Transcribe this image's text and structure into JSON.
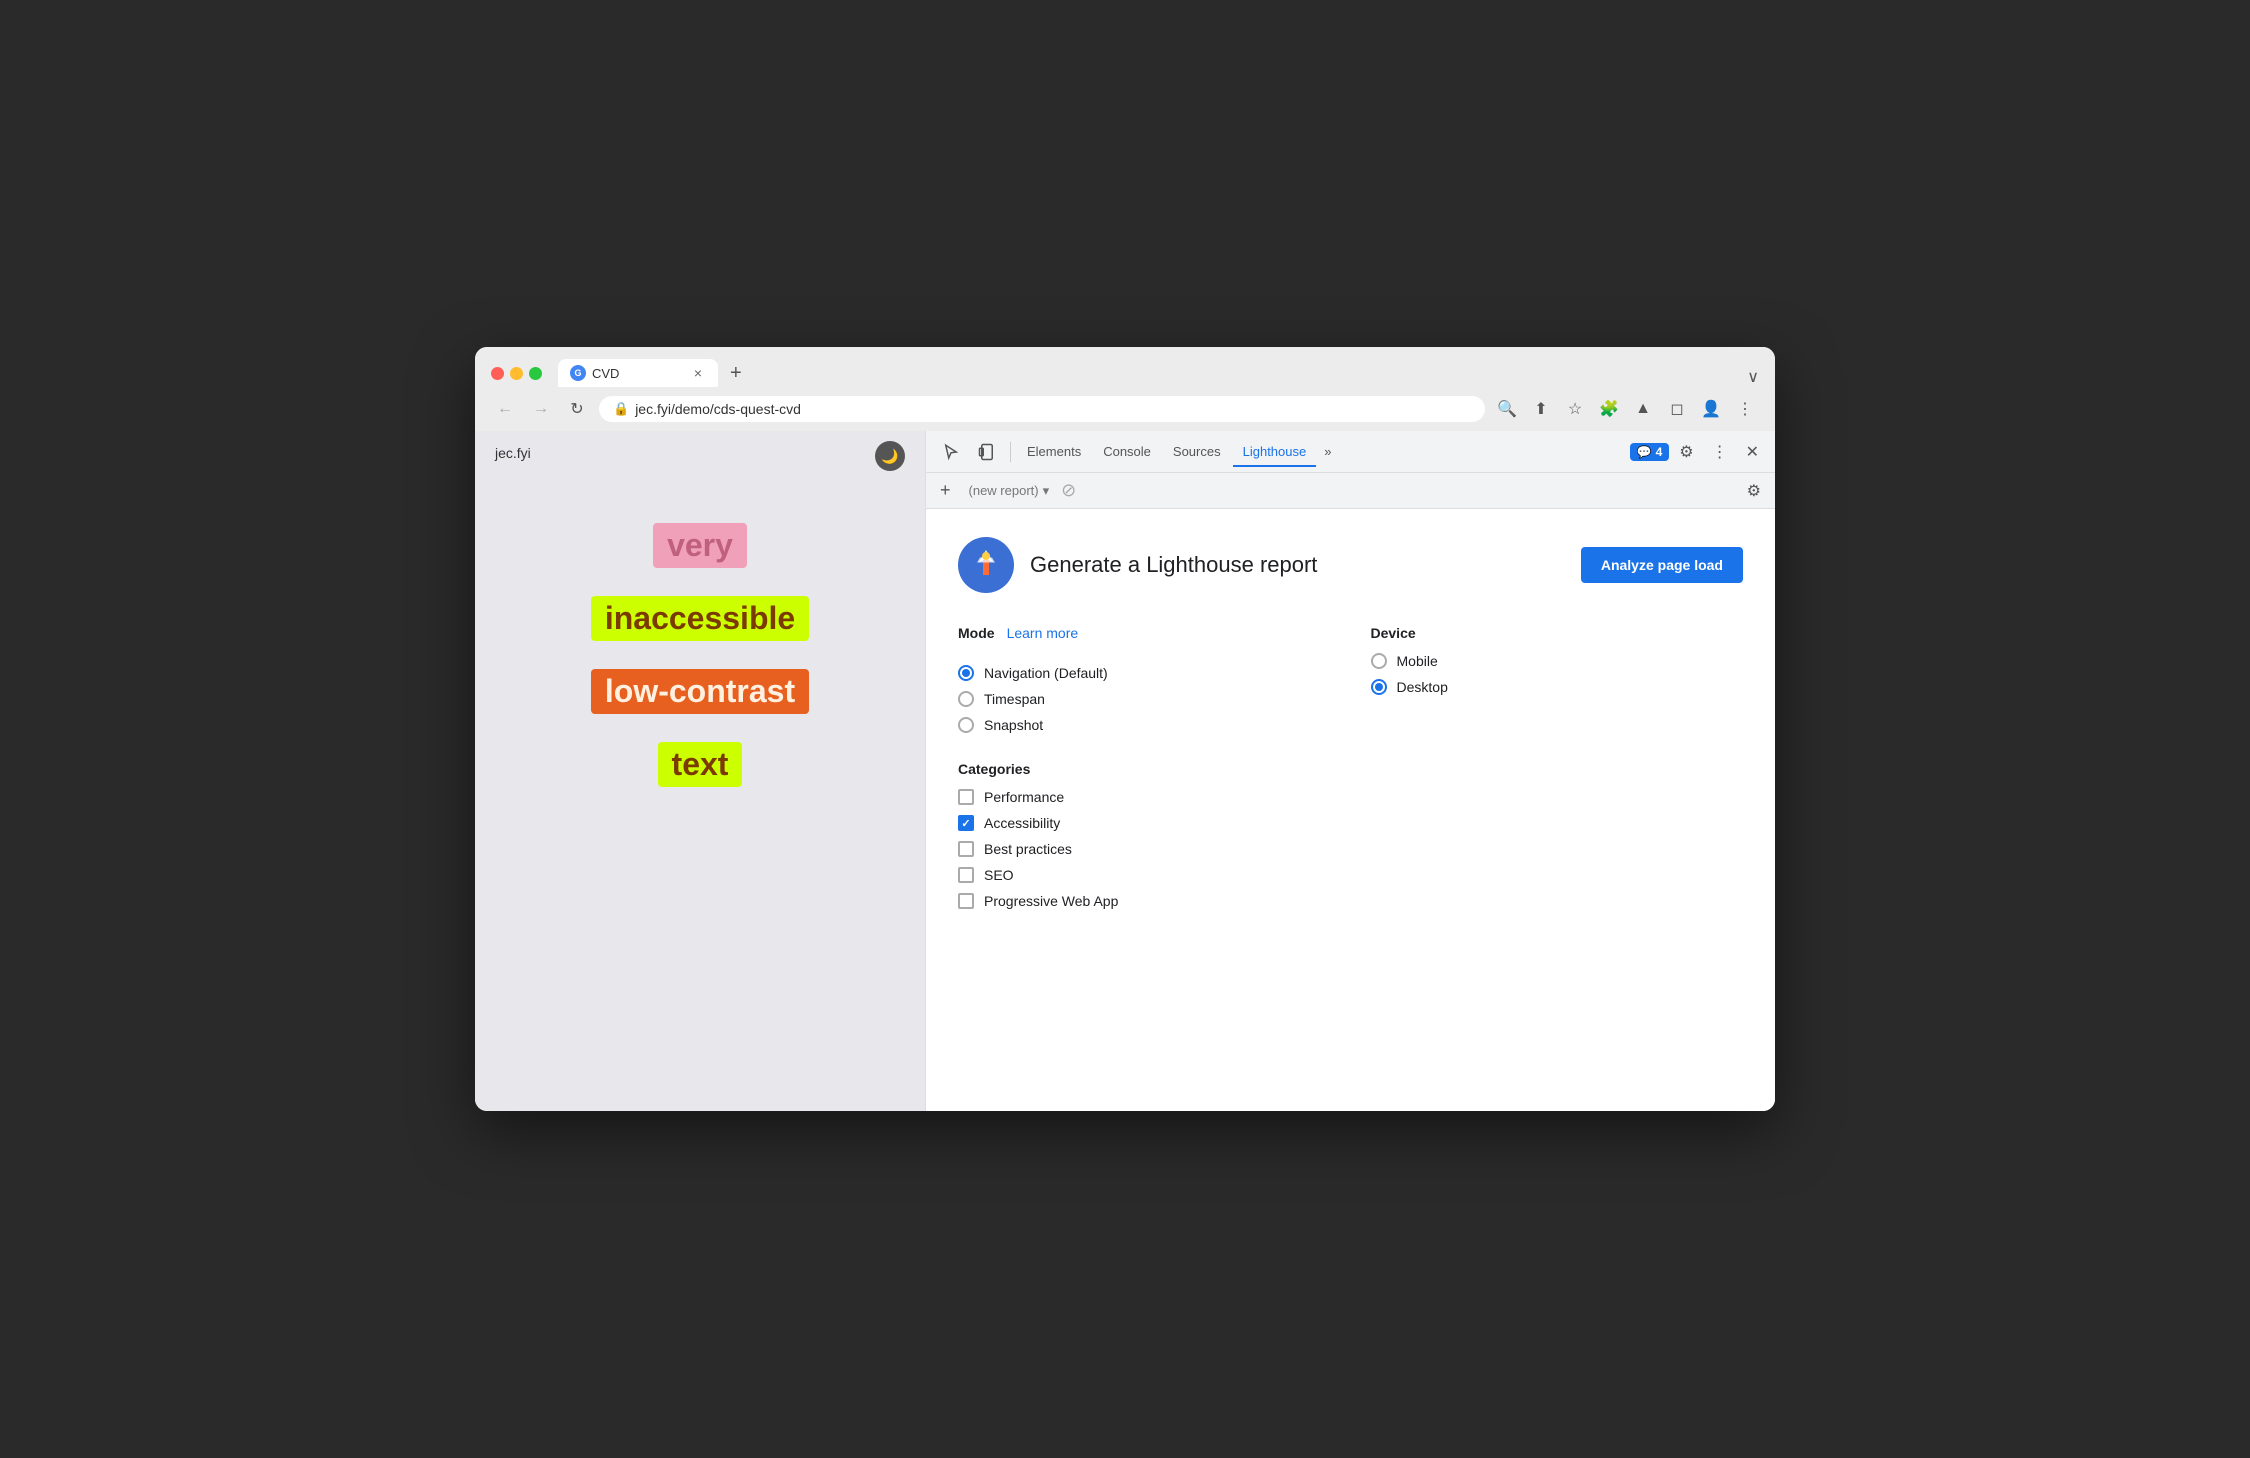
{
  "browser": {
    "tab": {
      "favicon": "G",
      "title": "CVD",
      "close_label": "×"
    },
    "new_tab_label": "+",
    "chevron_label": "∨",
    "url": "jec.fyi/demo/cds-quest-cvd",
    "nav": {
      "back_label": "←",
      "forward_label": "→",
      "refresh_label": "↻"
    },
    "toolbar_icons": [
      "🔍",
      "⬆",
      "★",
      "🧩",
      "▲",
      "◻",
      "👤",
      "⋮"
    ]
  },
  "webpage": {
    "site_name": "jec.fyi",
    "darkmode_icon": "🌙",
    "words": [
      {
        "text": "very",
        "bg": "#f0a0b8",
        "color": "#c06080"
      },
      {
        "text": "inaccessible",
        "bg": "#ccff00",
        "color": "#7b3a00"
      },
      {
        "text": "low-contrast",
        "bg": "#e86020",
        "color": "#fff0e0"
      },
      {
        "text": "text",
        "bg": "#ccff00",
        "color": "#7b3a00"
      }
    ]
  },
  "devtools": {
    "tabs": [
      {
        "label": "Elements",
        "active": false
      },
      {
        "label": "Console",
        "active": false
      },
      {
        "label": "Sources",
        "active": false
      },
      {
        "label": "Lighthouse",
        "active": true
      }
    ],
    "more_label": "»",
    "badge": {
      "icon": "💬",
      "count": "4"
    },
    "secondary_bar": {
      "new_report_label": "+",
      "report_placeholder": "(new report)",
      "dropdown_label": "▾",
      "block_icon": "⊘"
    },
    "lighthouse": {
      "title": "Generate a Lighthouse report",
      "analyze_btn": "Analyze page load",
      "mode_label": "Mode",
      "learn_more_label": "Learn more",
      "modes": [
        {
          "label": "Navigation (Default)",
          "checked": true
        },
        {
          "label": "Timespan",
          "checked": false
        },
        {
          "label": "Snapshot",
          "checked": false
        }
      ],
      "device_label": "Device",
      "devices": [
        {
          "label": "Mobile",
          "checked": false
        },
        {
          "label": "Desktop",
          "checked": true
        }
      ],
      "categories_label": "Categories",
      "categories": [
        {
          "label": "Performance",
          "checked": false
        },
        {
          "label": "Accessibility",
          "checked": true
        },
        {
          "label": "Best practices",
          "checked": false
        },
        {
          "label": "SEO",
          "checked": false
        },
        {
          "label": "Progressive Web App",
          "checked": false
        }
      ]
    }
  }
}
